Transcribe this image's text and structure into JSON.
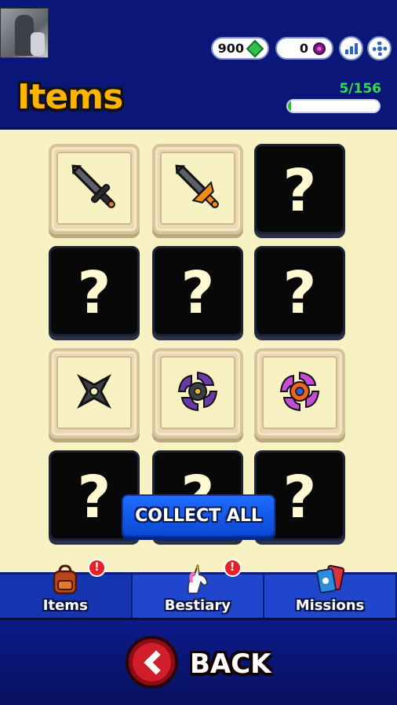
{
  "header": {
    "gems": "900",
    "orbs": "0",
    "title": "Items",
    "collected_count": "5/156",
    "progress_fraction": 0.032
  },
  "icons": {
    "gem": "green-gem-icon",
    "orb": "purple-orb-icon",
    "stats": "bar-chart-icon",
    "settings": "gear-icon"
  },
  "grid": {
    "tiles": [
      {
        "state": "unlocked",
        "icon": "gray-sword-icon"
      },
      {
        "state": "unlocked",
        "icon": "orange-sword-icon"
      },
      {
        "state": "locked",
        "text": "?"
      },
      {
        "state": "locked",
        "text": "?"
      },
      {
        "state": "locked",
        "text": "?"
      },
      {
        "state": "locked",
        "text": "?"
      },
      {
        "state": "unlocked",
        "icon": "shuriken-icon"
      },
      {
        "state": "unlocked",
        "icon": "purple-spinner-blade-icon"
      },
      {
        "state": "unlocked",
        "icon": "orange-spinner-blade-icon"
      },
      {
        "state": "locked",
        "text": "?"
      },
      {
        "state": "locked",
        "text": "?"
      },
      {
        "state": "locked",
        "text": "?"
      }
    ]
  },
  "collect_all_label": "COLLECT ALL",
  "tabs": [
    {
      "label": "Items",
      "icon": "backpack-icon",
      "badge": "!"
    },
    {
      "label": "Bestiary",
      "icon": "unicorn-icon",
      "badge": "!"
    },
    {
      "label": "Missions",
      "icon": "cards-icon",
      "badge": ""
    }
  ],
  "back_label": "BACK",
  "colors": {
    "header_bg": "#0a1678",
    "title": "#ffb400",
    "count": "#2ee04a",
    "grid_bg": "#f8f1c4",
    "collect_button": "#1e6cff",
    "back_button": "#d01e2b"
  }
}
